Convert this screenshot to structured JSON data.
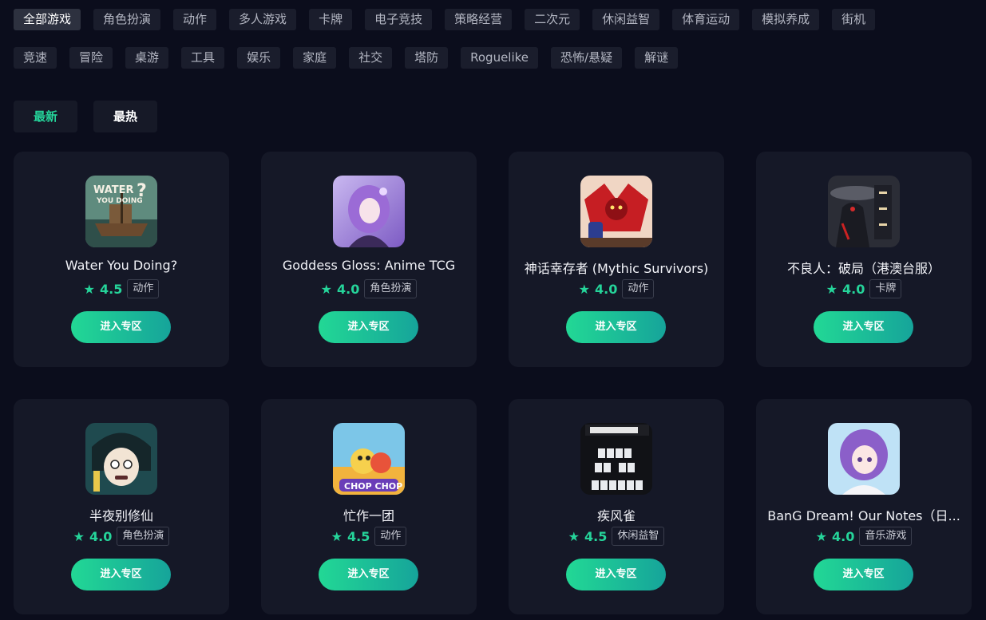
{
  "categories": {
    "row1": [
      "全部游戏",
      "角色扮演",
      "动作",
      "多人游戏",
      "卡牌",
      "电子竞技",
      "策略经营",
      "二次元",
      "休闲益智",
      "体育运动",
      "模拟养成",
      "街机"
    ],
    "row2": [
      "竞速",
      "冒险",
      "桌游",
      "工具",
      "娱乐",
      "家庭",
      "社交",
      "塔防",
      "Roguelike",
      "恐怖/悬疑",
      "解谜"
    ]
  },
  "sort_tabs": [
    "最新",
    "最热"
  ],
  "cards": [
    {
      "name": "Water You Doing?",
      "rating": "4.5",
      "genre": "动作",
      "button": "进入专区"
    },
    {
      "name": "Goddess Gloss: Anime TCG",
      "rating": "4.0",
      "genre": "角色扮演",
      "button": "进入专区"
    },
    {
      "name": "神话幸存者 (Mythic Survivors)",
      "rating": "4.0",
      "genre": "动作",
      "button": "进入专区"
    },
    {
      "name": "不良人：破局（港澳台服）",
      "rating": "4.0",
      "genre": "卡牌",
      "button": "进入专区"
    },
    {
      "name": "半夜别修仙",
      "rating": "4.0",
      "genre": "角色扮演",
      "button": "进入专区"
    },
    {
      "name": "忙作一团",
      "rating": "4.5",
      "genre": "动作",
      "button": "进入专区"
    },
    {
      "name": "疾风雀",
      "rating": "4.5",
      "genre": "休闲益智",
      "button": "进入专区"
    },
    {
      "name": "BanG Dream! Our Notes（日...",
      "rating": "4.0",
      "genre": "音乐游戏",
      "button": "进入专区"
    }
  ],
  "icons": {
    "rating": "star-icon"
  },
  "colors": {
    "accent": "#25d49a",
    "background": "#0b0d1c",
    "card": "#151827"
  }
}
